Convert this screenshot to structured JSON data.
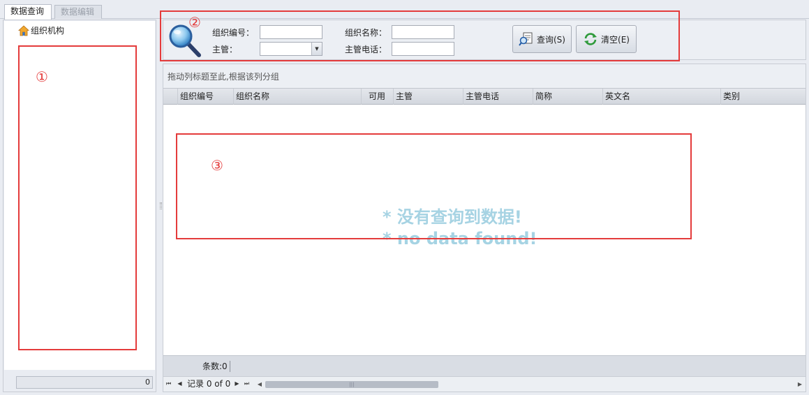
{
  "tabs": [
    {
      "label": "数据查询",
      "active": true
    },
    {
      "label": "数据编辑",
      "active": false
    }
  ],
  "left_panel": {
    "tree_root": "组织机构",
    "status_value": "0"
  },
  "search": {
    "org_code_label": "组织编号：",
    "org_code_value": "",
    "supervisor_label": "主管：",
    "supervisor_value": "",
    "org_name_label": "组织名称：",
    "org_name_value": "",
    "supervisor_phone_label": "主管电话：",
    "supervisor_phone_value": "",
    "query_button": "查询(S)",
    "clear_button": "清空(E)"
  },
  "grid": {
    "group_panel_text": "拖动列标题至此,根据该列分组",
    "columns": [
      "组织编号",
      "组织名称",
      "可用",
      "主管",
      "主管电话",
      "简称",
      "英文名",
      "类别"
    ],
    "empty_message_cn": "* 没有查询到数据!",
    "empty_message_en": "* no data found!",
    "footer_count": "条数:0",
    "record_nav": "记录 0 of 0",
    "scroll_grip": "|||"
  },
  "annotations": [
    "①",
    "②",
    "③"
  ],
  "colors": {
    "annotation": "#e43b3b",
    "empty_message": "#a6d3e3"
  }
}
